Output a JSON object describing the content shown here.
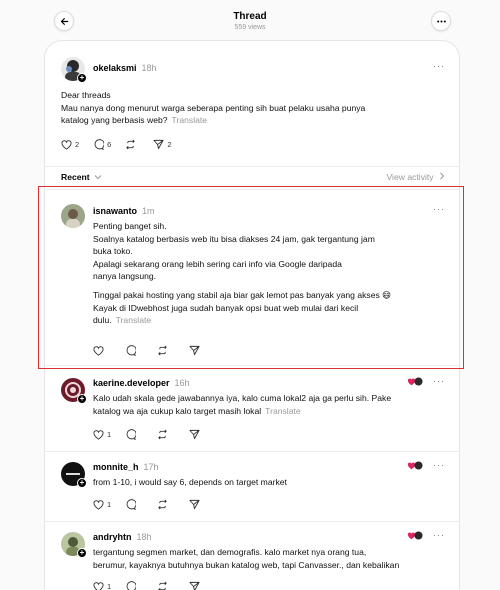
{
  "header": {
    "title": "Thread",
    "views": "559 views"
  },
  "main_post": {
    "username": "okelaksmi",
    "time": "18h",
    "lines": [
      "Dear threads",
      "Mau nanya dong menurut warga seberapa penting sih buat pelaku usaha punya",
      "katalog yang berbasis web?"
    ],
    "translate": "Translate",
    "likes": "2",
    "replies": "6",
    "shares": "2"
  },
  "filter": {
    "label": "Recent",
    "view_activity": "View activity"
  },
  "replies": [
    {
      "username": "isnawanto",
      "time": "1m",
      "paragraphs": [
        [
          "Penting banget sih.",
          "Soalnya katalog berbasis web itu bisa diakses 24 jam, gak tergantung jam",
          "buka toko.",
          "Apalagi sekarang orang lebih sering cari info via Google daripada",
          "nanya langsung."
        ],
        [
          "Tinggal pakai hosting yang stabil aja biar gak lemot pas banyak yang akses 😄",
          "Kayak di IDwebhost juga sudah banyak opsi buat web mulai dari kecil",
          "dulu."
        ]
      ],
      "translate": "Translate"
    },
    {
      "username": "kaerine.developer",
      "time": "16h",
      "lines": [
        "Kalo udah skala gede jawabannya iya, kalo cuma lokal2 aja ga perlu sih. Pake",
        "katalog wa aja cukup kalo target masih lokal"
      ],
      "translate": "Translate",
      "likes": "1"
    },
    {
      "username": "monnite_h",
      "time": "17h",
      "lines": [
        "from 1-10, i would say 6, depends on target market"
      ],
      "likes": "1"
    },
    {
      "username": "andryhtn",
      "time": "18h",
      "lines": [
        "tergantung segmen market, dan demografis. kalo market nya orang tua,",
        "berumur, kayaknya butuhnya bukan katalog web, tapi Canvasser., dan kebalikan"
      ],
      "likes": "1"
    }
  ],
  "colors": {
    "highlight": "#d93030",
    "like_red": "#e0245e",
    "muted": "#999999"
  }
}
